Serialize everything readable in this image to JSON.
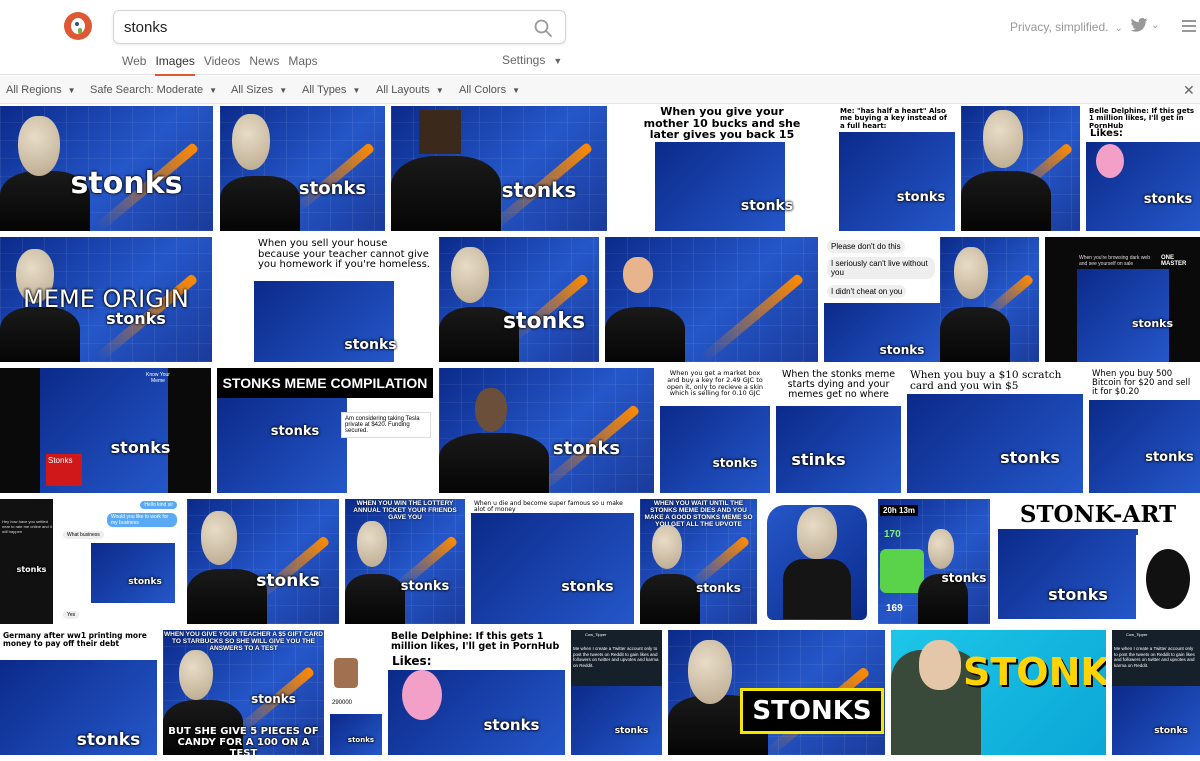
{
  "search": {
    "query": "stonks"
  },
  "nav": {
    "tabs": [
      "Web",
      "Images",
      "Videos",
      "News",
      "Maps"
    ],
    "active": "Images",
    "settings_label": "Settings"
  },
  "header": {
    "privacy_label": "Privacy, simplified."
  },
  "filters": [
    "All Regions",
    "Safe Search: Moderate",
    "All Sizes",
    "All Types",
    "All Layouts",
    "All Colors"
  ],
  "icons": {
    "search": "search-icon",
    "twitter": "twitter-icon",
    "menu": "hamburger-menu-icon",
    "close": "close-icon",
    "logo": "duckduckgo-logo-icon"
  },
  "colors": {
    "accent": "#de5833",
    "chart_blue": "#2557c9",
    "arrow": "#ff8a00"
  },
  "tiles": {
    "t0": {
      "caption": "stonks"
    },
    "t1": {
      "caption": "stonks"
    },
    "t2": {
      "caption": "stonks"
    },
    "t3": {
      "top": "When you give your mother 10 bucks and she later gives you back 15 bucks",
      "caption": "stonks"
    },
    "t4": {
      "top": "Me: \"has half a heart\" Also me buying a key instead of a full heart:",
      "caption": "stonks"
    },
    "t5": {
      "caption": ""
    },
    "t6": {
      "top": "Belle Delphine: If this gets 1 million likes, I'll get in PornHub",
      "sub": "Likes:",
      "caption": "stonks"
    },
    "t7": {
      "caption": "MEME ORIGIN",
      "sub": "stonks"
    },
    "t8": {
      "top": "When you sell your house because your teacher cannot give you homework if you're homeless.",
      "caption": "stonks"
    },
    "t9": {
      "caption": "stonks"
    },
    "t10": {
      "caption": ""
    },
    "t11": {
      "chat1": "Please don't do this",
      "chat2": "I seriously can't live without you",
      "chat3": "I didn't cheat on you",
      "caption": "stonks"
    },
    "t12": {
      "caption": ""
    },
    "t13": {
      "top": "When you're browsing dark web and see yourself on sale",
      "side": "ONE MASTER",
      "caption": "stonks"
    },
    "t14": {
      "side": "Know Your Meme",
      "label": "Stonks",
      "caption": "stonks"
    },
    "t15": {
      "banner": "STONKS MEME COMPILATION",
      "tweet": "Am considering taking Tesla private at $420. Funding secured.",
      "caption": "stonks"
    },
    "t16": {
      "caption": "stonks"
    },
    "t17": {
      "top": "When you get a market box and buy a key for 2.49 GJC to open it, only to recieve a skin which is selling for 0.10 GJC",
      "caption": "stonks"
    },
    "t18": {
      "top": "When the stonks meme starts dying and your memes get no where",
      "caption": "stinks"
    },
    "t19": {
      "top": "When you buy a $10 scratch card and you win $5",
      "caption": "stonks"
    },
    "t20": {
      "top": "When you buy 500 Bitcoin for $20 and sell it for $0.20",
      "caption": "stonks"
    },
    "t21": {
      "top": "Hey how have you settled near to rate me online and it will happen",
      "caption": "stonks"
    },
    "t22": {
      "chat1": "Hello kind sir",
      "chat2": "Would you like to work for my business",
      "chat3": "What business",
      "chat4": "Yes",
      "caption": "stonks"
    },
    "t23": {
      "caption": "stonks"
    },
    "t24": {
      "banner": "WHEN YOU WIN THE LOTTERY ANNUAL TICKET YOUR FRIENDS GAVE YOU",
      "caption": "stonks"
    },
    "t25": {
      "top": "When u die and become super famous so u make alot of money",
      "caption": "stonks"
    },
    "t26": {
      "banner": "WHEN YOU WAIT UNTIL THE STONKS MEME DIES AND YOU MAKE A GOOD STONKS MEME SO YOU GET ALL THE UPVOTE",
      "caption": "stonks"
    },
    "t27": {
      "caption": ""
    },
    "t28": {
      "timer": "20h 13m",
      "v1": "170",
      "v2": "169",
      "caption": "stonks"
    },
    "t29": {
      "banner": "STONK-ART",
      "caption": "stonks"
    },
    "t30": {
      "top": "Germany after ww1 printing more money to pay off their debt",
      "caption": "stonks"
    },
    "t31": {
      "banner": "WHEN YOU GIVE YOUR TEACHER A $5 GIFT CARD TO STARBUCKS SO SHE WILL GIVE YOU THE ANSWERS TO A TEST",
      "bottom": "BUT SHE GIVE 5 PIECES OF CANDY FOR A 100 ON A TEST",
      "caption": "stonks"
    },
    "t32": {
      "price": "290000",
      "caption": "stonks"
    },
    "t33": {
      "top": "Belle Delphine: If this gets 1 million likes, I'll get in PornHub",
      "sub": "Likes:",
      "caption": "stonks"
    },
    "t34": {
      "user": "Cow_Tipper",
      "tweet": "Me when I create a Twitter account only to post the tweets on Reddit to gain likes and followers on twitter and upvotes and karma on Reddit.",
      "caption": "stonks"
    },
    "t35": {
      "caption": "STONKS"
    },
    "t36": {
      "caption": "STONKS"
    },
    "t37": {
      "user": "Cow_Tipper",
      "tweet": "Me when I create a Twitter account only to post the tweets on Reddit to gain likes and followers on twitter and upvotes and karma on Reddit.",
      "caption": "stonks"
    }
  }
}
